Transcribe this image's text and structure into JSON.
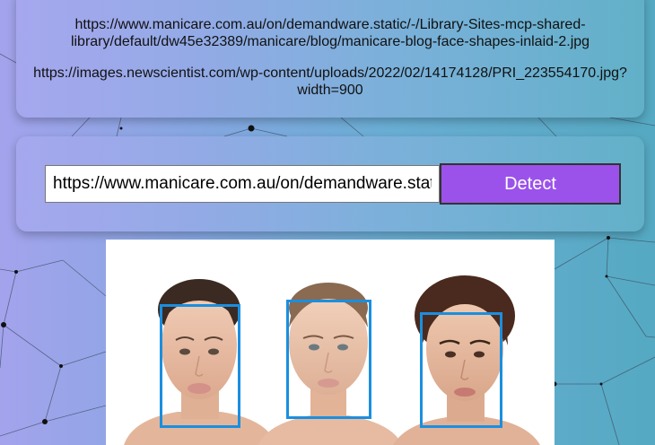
{
  "url_list": [
    "https://www.manicare.com.au/on/demandware.static/-/Library-Sites-mcp-shared-library/default/dw45e32389/manicare/blog/manicare-blog-face-shapes-inlaid-2.jpg",
    "https://images.newscientist.com/wp-content/uploads/2022/02/14174128/PRI_223554170.jpg?width=900"
  ],
  "url_list_lines": [
    [
      "https://www.manicare.com.au/on/demandware.static/-/Library-Sites-mcp-shared-",
      "library/default/dw45e32389/manicare/blog/manicare-blog-face-shapes-inlaid-2.jpg"
    ],
    [
      "https://images.newscientist.com/wp-content/uploads/2022/02/14174128/PRI_223554170.jpg?",
      "width=900"
    ]
  ],
  "detector": {
    "input_value": "https://www.manicare.com.au/on/demandware.static/-/Library-Sites-mcp-shared-library/default/dw45e32389/manicare/blog/manicare-blog-face-shapes-inlaid-2.jpg",
    "button_label": "Detect"
  },
  "detections": {
    "face_count": 3,
    "box_color": "#1a8fe0"
  },
  "colors": {
    "button": "#9b52ea",
    "background_start": "#a3a3ec",
    "background_end": "#55a9c2"
  }
}
